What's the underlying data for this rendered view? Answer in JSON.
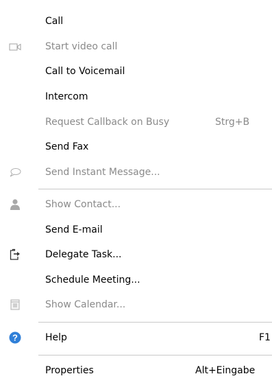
{
  "menu": {
    "items": [
      {
        "label": "Call",
        "shortcut": "",
        "enabled": true,
        "icon": ""
      },
      {
        "label": "Start video call",
        "shortcut": "",
        "enabled": false,
        "icon": "video-camera-icon"
      },
      {
        "label": "Call to Voicemail",
        "shortcut": "",
        "enabled": true,
        "icon": ""
      },
      {
        "label": "Intercom",
        "shortcut": "",
        "enabled": true,
        "icon": ""
      },
      {
        "label": "Request Callback on Busy",
        "shortcut": "Strg+B",
        "enabled": false,
        "icon": ""
      },
      {
        "label": "Send Fax",
        "shortcut": "",
        "enabled": true,
        "icon": ""
      },
      {
        "label": "Send Instant Message...",
        "shortcut": "",
        "enabled": false,
        "icon": "chat-bubble-icon"
      },
      {
        "label": "Show Contact...",
        "shortcut": "",
        "enabled": false,
        "icon": "contact-person-icon"
      },
      {
        "label": "Send E-mail",
        "shortcut": "",
        "enabled": true,
        "icon": ""
      },
      {
        "label": "Delegate Task...",
        "shortcut": "",
        "enabled": true,
        "icon": "delegate-task-icon"
      },
      {
        "label": "Schedule Meeting...",
        "shortcut": "",
        "enabled": true,
        "icon": ""
      },
      {
        "label": "Show Calendar...",
        "shortcut": "",
        "enabled": false,
        "icon": "calendar-icon"
      },
      {
        "label": "Help",
        "shortcut": "F1",
        "enabled": true,
        "icon": "help-question-icon"
      },
      {
        "label": "Properties",
        "shortcut": "Alt+Eingabe",
        "enabled": true,
        "icon": ""
      }
    ]
  },
  "colors": {
    "text": "#000000",
    "disabled_text": "#8a8a8a",
    "separator": "#c8c8c8",
    "help_icon": "#2f7fd8",
    "background": "#ffffff"
  }
}
